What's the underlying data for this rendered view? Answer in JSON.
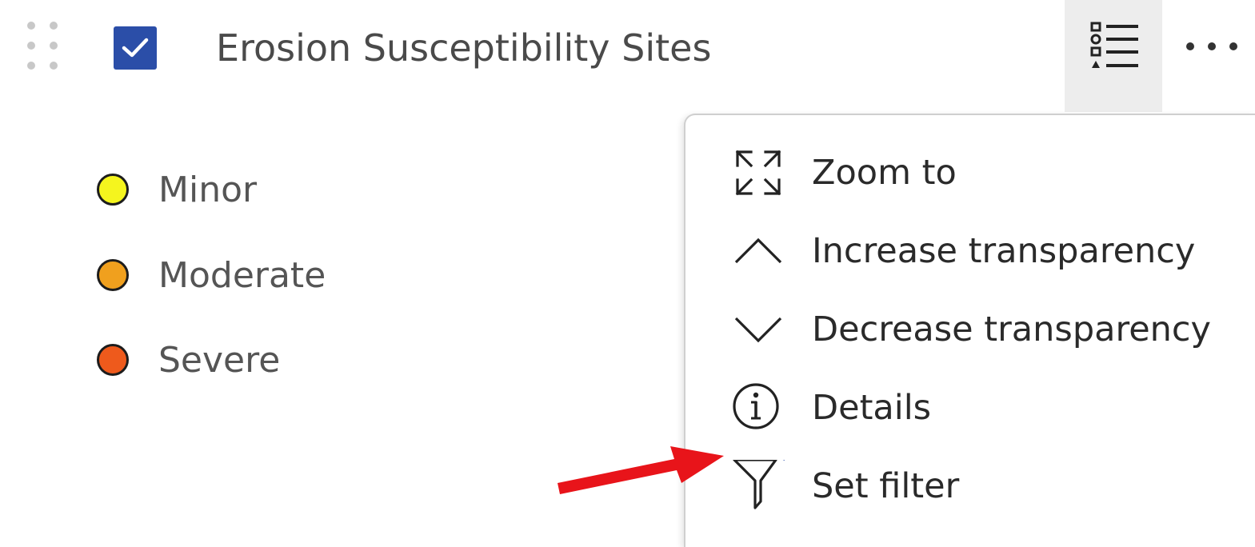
{
  "layer": {
    "title": "Erosion Susceptibility Sites",
    "checked": true
  },
  "legend": [
    {
      "label": "Minor",
      "color": "#f5f51e"
    },
    {
      "label": "Moderate",
      "color": "#f0a01e"
    },
    {
      "label": "Severe",
      "color": "#ee5a1c"
    }
  ],
  "menu": {
    "items": [
      {
        "label": "Zoom to",
        "icon": "zoom-to-icon"
      },
      {
        "label": "Increase transparency",
        "icon": "chevron-up-icon"
      },
      {
        "label": "Decrease transparency",
        "icon": "chevron-down-icon"
      },
      {
        "label": "Details",
        "icon": "info-icon"
      },
      {
        "label": "Set filter",
        "icon": "filter-icon",
        "indicator": true
      }
    ]
  },
  "colors": {
    "accent": "#2b4ea8",
    "annotation_arrow": "#e8141a"
  }
}
